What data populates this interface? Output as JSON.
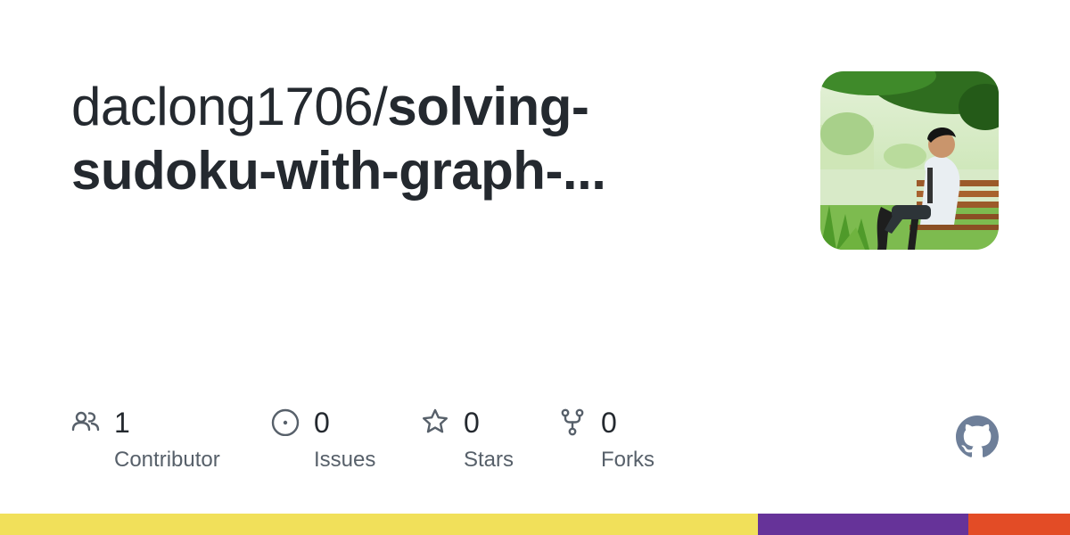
{
  "repo": {
    "owner": "daclong1706/",
    "name_line1": "solving-",
    "name_line2": "sudoku-with-graph-..."
  },
  "stats": {
    "contributors": {
      "value": "1",
      "label": "Contributor",
      "icon": "people-icon"
    },
    "issues": {
      "value": "0",
      "label": "Issues",
      "icon": "issue-opened-icon"
    },
    "stars": {
      "value": "0",
      "label": "Stars",
      "icon": "star-icon"
    },
    "forks": {
      "value": "0",
      "label": "Forks",
      "icon": "repo-forked-icon"
    }
  },
  "avatar": {
    "icon": "profile-photo"
  },
  "logo": {
    "icon": "github-mark-icon",
    "color": "#6e7f99"
  },
  "colors": {
    "title": "#24292f",
    "label": "#57606a",
    "icon": "#57606a"
  },
  "languages": [
    {
      "color": "#f1e05a",
      "share": 0.708
    },
    {
      "color": "#663399",
      "share": 0.197
    },
    {
      "color": "#e34c26",
      "share": 0.095
    }
  ]
}
